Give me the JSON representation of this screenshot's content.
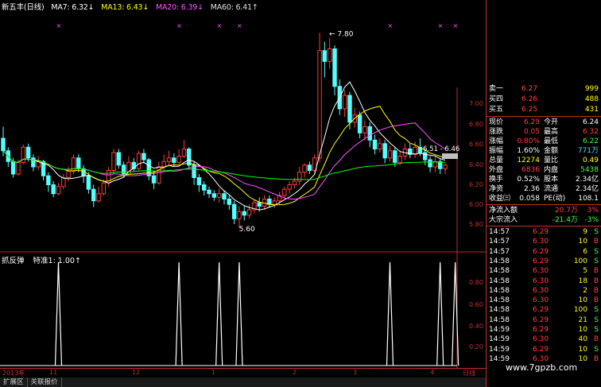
{
  "header": {
    "title": "新五丰(日线)",
    "ma": [
      {
        "label": "MA7: 6.32↓",
        "color": "#ffffff"
      },
      {
        "label": "MA13: 6.43↓",
        "color": "#ffff00"
      },
      {
        "label": "MA20: 6.39↓",
        "color": "#ff55ff"
      },
      {
        "label": "MA60: 6.41↑",
        "color": "#e0e0e0"
      }
    ]
  },
  "sub_header": {
    "name": "抓反弹",
    "label": "特准1: 1.00↑"
  },
  "price_axis": [
    "7.00",
    "6.80",
    "6.60",
    "6.40",
    "6.20",
    "6.00",
    "5.80"
  ],
  "sub_axis": [
    "0.80",
    "0.60",
    "0.40",
    "0.20"
  ],
  "annotations": {
    "high": "7.80",
    "low": "5.60",
    "range": "6.51 - 6.46"
  },
  "date_axis": {
    "year": "2013年",
    "labels": [
      "11",
      "12",
      "1",
      "2",
      "3",
      "4"
    ],
    "period": "日线"
  },
  "tabs": [
    "扩展区",
    "关联报价"
  ],
  "panel": {
    "asks": [
      {
        "label": "卖一",
        "price": "6.27",
        "vol": "999"
      },
      {
        "label": "买四",
        "price": "6.26",
        "vol": "488"
      },
      {
        "label": "买五",
        "price": "6.25",
        "vol": "431"
      }
    ],
    "stats": [
      {
        "l1": "现价",
        "v1": "6.29",
        "l2": "今开",
        "v2": "6.24",
        "c1": "#ff4040",
        "c2": "#ffffff"
      },
      {
        "l1": "涨跌",
        "v1": "0.05",
        "l2": "最高",
        "v2": "6.32",
        "c1": "#ff4040",
        "c2": "#ff4040"
      },
      {
        "l1": "涨幅",
        "v1": "0.80%",
        "l2": "最低",
        "v2": "6.22",
        "c1": "#ff4040",
        "c2": "#40ff40"
      },
      {
        "l1": "振幅",
        "v1": "1.60%",
        "l2": "金额",
        "v2": "771万",
        "c1": "#ffffff",
        "c2": "#40e0ff"
      },
      {
        "l1": "总量",
        "v1": "12274",
        "l2": "量比",
        "v2": "0.49",
        "c1": "#ffff00",
        "c2": "#ffff00"
      },
      {
        "l1": "外盘",
        "v1": "6836",
        "l2": "内盘",
        "v2": "5438",
        "c1": "#ff4040",
        "c2": "#40ff40"
      },
      {
        "l1": "换手",
        "v1": "0.52%",
        "l2": "股本",
        "v2": "2.34亿",
        "c1": "#ffffff",
        "c2": "#ffffff"
      },
      {
        "l1": "净资",
        "v1": "2.36",
        "l2": "流通",
        "v2": "2.34亿",
        "c1": "#ffffff",
        "c2": "#ffffff"
      },
      {
        "l1": "收益㈢",
        "v1": "0.058",
        "l2": "PE(动)",
        "v2": "108.1",
        "c1": "#ffffff",
        "c2": "#ffffff"
      }
    ],
    "flows": [
      {
        "label": "净流入额",
        "v": "20.7万",
        "p": "3%",
        "c": "#ff4040"
      },
      {
        "label": "大宗流入",
        "v": "-21.4万",
        "p": "-3%",
        "c": "#40ff40"
      }
    ],
    "ticks": [
      {
        "t": "14:57",
        "p": "6.29",
        "v": "9",
        "d": "S",
        "pc": "#ff4040",
        "dc": "#40ff40"
      },
      {
        "t": "14:57",
        "p": "6.30",
        "v": "10",
        "d": "B",
        "pc": "#ff4040",
        "dc": "#ff4040"
      },
      {
        "t": "14:57",
        "p": "6.29",
        "v": "6",
        "d": "S",
        "pc": "#ff4040",
        "dc": "#40ff40"
      },
      {
        "t": "14:58",
        "p": "6.29",
        "v": "100",
        "d": "S",
        "pc": "#ff4040",
        "dc": "#40ff40"
      },
      {
        "t": "14:58",
        "p": "6.30",
        "v": "5",
        "d": "B",
        "pc": "#ff4040",
        "dc": "#ff4040"
      },
      {
        "t": "14:58",
        "p": "6.30",
        "v": "18",
        "d": "B",
        "pc": "#ff4040",
        "dc": "#ff4040"
      },
      {
        "t": "14:58",
        "p": "6.30",
        "v": "2",
        "d": "B",
        "pc": "#ff4040",
        "dc": "#ff4040"
      },
      {
        "t": "14:58",
        "p": "6.30",
        "v": "10",
        "d": "B",
        "pc": "#ff4040",
        "dc": "#ff4040"
      },
      {
        "t": "14:58",
        "p": "6.29",
        "v": "100",
        "d": "S",
        "pc": "#ff4040",
        "dc": "#40ff40"
      },
      {
        "t": "14:58",
        "p": "6.29",
        "v": "21",
        "d": "S",
        "pc": "#ff4040",
        "dc": "#40ff40"
      },
      {
        "t": "14:59",
        "p": "6.29",
        "v": "10",
        "d": "S",
        "pc": "#ff4040",
        "dc": "#40ff40"
      },
      {
        "t": "14:59",
        "p": "6.30",
        "v": "40",
        "d": "B",
        "pc": "#ff4040",
        "dc": "#ff4040"
      },
      {
        "t": "14:59",
        "p": "6.29",
        "v": "10",
        "d": "S",
        "pc": "#ff4040",
        "dc": "#40ff40"
      },
      {
        "t": "14:59",
        "p": "6.30",
        "v": "10",
        "d": "B",
        "pc": "#ff4040",
        "dc": "#ff4040"
      }
    ]
  },
  "watermark": "www.7gpzb.com",
  "chart_data": {
    "type": "candlestick",
    "ylim": [
      5.5,
      7.9
    ],
    "candles": [
      [
        6.62,
        6.48,
        6.75,
        6.42
      ],
      [
        6.48,
        6.36,
        6.52,
        6.3
      ],
      [
        6.36,
        6.22,
        6.4,
        6.18
      ],
      [
        6.22,
        6.35,
        6.38,
        6.2
      ],
      [
        6.35,
        6.52,
        6.55,
        6.33
      ],
      [
        6.52,
        6.4,
        6.56,
        6.36
      ],
      [
        6.4,
        6.3,
        6.44,
        6.25
      ],
      [
        6.3,
        6.36,
        6.42,
        6.26
      ],
      [
        6.36,
        6.2,
        6.38,
        6.15
      ],
      [
        6.2,
        6.1,
        6.24,
        6.02
      ],
      [
        6.1,
        6.0,
        6.14,
        5.96
      ],
      [
        6.0,
        6.08,
        6.12,
        5.98
      ],
      [
        6.08,
        6.18,
        6.22,
        6.05
      ],
      [
        6.18,
        6.25,
        6.3,
        6.14
      ],
      [
        6.25,
        6.4,
        6.44,
        6.22
      ],
      [
        6.4,
        6.28,
        6.44,
        6.24
      ],
      [
        6.28,
        6.2,
        6.32,
        6.12
      ],
      [
        6.2,
        6.05,
        6.24,
        6.0
      ],
      [
        6.05,
        5.92,
        6.1,
        5.85
      ],
      [
        5.92,
        6.0,
        6.08,
        5.9
      ],
      [
        6.0,
        6.12,
        6.16,
        5.98
      ],
      [
        6.12,
        6.26,
        6.3,
        6.08
      ],
      [
        6.26,
        6.46,
        6.5,
        6.22
      ],
      [
        6.46,
        6.32,
        6.5,
        6.28
      ],
      [
        6.32,
        6.22,
        6.36,
        6.18
      ],
      [
        6.22,
        6.35,
        6.42,
        6.2
      ],
      [
        6.35,
        6.28,
        6.4,
        6.25
      ],
      [
        6.28,
        6.45,
        6.48,
        6.26
      ],
      [
        6.45,
        6.38,
        6.5,
        6.34
      ],
      [
        6.38,
        6.2,
        6.4,
        6.15
      ],
      [
        6.2,
        6.12,
        6.26,
        6.05
      ],
      [
        6.12,
        6.3,
        6.36,
        6.1
      ],
      [
        6.3,
        6.36,
        6.44,
        6.26
      ],
      [
        6.36,
        6.4,
        6.48,
        6.32
      ],
      [
        6.4,
        6.35,
        6.45,
        6.3
      ],
      [
        6.35,
        6.42,
        6.5,
        6.33
      ],
      [
        6.42,
        6.5,
        6.6,
        6.4
      ],
      [
        6.5,
        6.32,
        6.52,
        6.28
      ],
      [
        6.32,
        6.18,
        6.36,
        6.1
      ],
      [
        6.18,
        6.1,
        6.22,
        6.02
      ],
      [
        6.1,
        6.04,
        6.14,
        5.98
      ],
      [
        6.04,
        6.0,
        6.08,
        5.95
      ],
      [
        6.0,
        5.96,
        6.04,
        5.92
      ],
      [
        5.96,
        6.0,
        6.06,
        5.9
      ],
      [
        6.0,
        5.94,
        6.04,
        5.88
      ],
      [
        5.94,
        5.88,
        5.98,
        5.82
      ],
      [
        5.88,
        5.72,
        5.92,
        5.66
      ],
      [
        5.72,
        5.8,
        5.86,
        5.62
      ],
      [
        5.8,
        5.76,
        5.86,
        5.7
      ],
      [
        5.76,
        5.82,
        5.88,
        5.72
      ],
      [
        5.82,
        5.9,
        5.94,
        5.78
      ],
      [
        5.9,
        5.86,
        5.96,
        5.8
      ],
      [
        5.86,
        5.94,
        5.98,
        5.82
      ],
      [
        5.94,
        5.88,
        5.98,
        5.84
      ],
      [
        5.88,
        5.92,
        5.96,
        5.84
      ],
      [
        5.92,
        5.98,
        6.02,
        5.88
      ],
      [
        5.98,
        6.05,
        6.08,
        5.95
      ],
      [
        6.05,
        6.1,
        6.14,
        6.0
      ],
      [
        6.1,
        6.14,
        6.18,
        6.06
      ],
      [
        6.14,
        6.24,
        6.3,
        6.1
      ],
      [
        6.24,
        6.32,
        6.34,
        6.18
      ],
      [
        6.32,
        6.26,
        6.36,
        6.22
      ],
      [
        6.26,
        6.4,
        6.44,
        6.22
      ],
      [
        6.4,
        7.6,
        7.8,
        6.35
      ],
      [
        7.6,
        7.48,
        7.7,
        7.3
      ],
      [
        7.48,
        7.62,
        7.74,
        7.4
      ],
      [
        7.62,
        7.2,
        7.66,
        7.1
      ],
      [
        7.2,
        6.95,
        7.28,
        6.88
      ],
      [
        6.95,
        7.1,
        7.16,
        6.86
      ],
      [
        7.1,
        6.8,
        7.14,
        6.72
      ],
      [
        6.8,
        6.88,
        6.96,
        6.74
      ],
      [
        6.88,
        6.68,
        6.92,
        6.62
      ],
      [
        6.68,
        6.75,
        6.82,
        6.6
      ],
      [
        6.75,
        6.6,
        6.8,
        6.52
      ],
      [
        6.6,
        6.5,
        6.66,
        6.44
      ],
      [
        6.5,
        6.56,
        6.62,
        6.46
      ],
      [
        6.56,
        6.4,
        6.6,
        6.34
      ],
      [
        6.4,
        6.48,
        6.54,
        6.36
      ],
      [
        6.48,
        6.35,
        6.52,
        6.3
      ],
      [
        6.35,
        6.42,
        6.48,
        6.32
      ],
      [
        6.42,
        6.5,
        6.56,
        6.38
      ],
      [
        6.5,
        6.44,
        6.56,
        6.4
      ],
      [
        6.44,
        6.52,
        6.58,
        6.4
      ],
      [
        6.52,
        6.46,
        6.62,
        6.42
      ],
      [
        6.46,
        6.38,
        6.5,
        6.32
      ],
      [
        6.38,
        6.3,
        6.42,
        6.24
      ],
      [
        6.3,
        6.36,
        6.42,
        6.24
      ],
      [
        6.36,
        6.28,
        6.4,
        6.22
      ],
      [
        6.28,
        6.32,
        6.34,
        6.22
      ]
    ],
    "ma_series": [
      {
        "name": "MA7",
        "color": "#ffffff"
      },
      {
        "name": "MA13",
        "color": "#ffff00"
      },
      {
        "name": "MA20",
        "color": "#ff55ff"
      },
      {
        "name": "MA60",
        "color": "#00ff00"
      }
    ],
    "signals": [
      {
        "index": 11,
        "value": 1
      },
      {
        "index": 35,
        "value": 1
      },
      {
        "index": 43,
        "value": 1
      },
      {
        "index": 47,
        "value": 1
      },
      {
        "index": 77,
        "value": 1
      },
      {
        "index": 87,
        "value": 1
      },
      {
        "index": 90,
        "value": 1
      }
    ]
  }
}
